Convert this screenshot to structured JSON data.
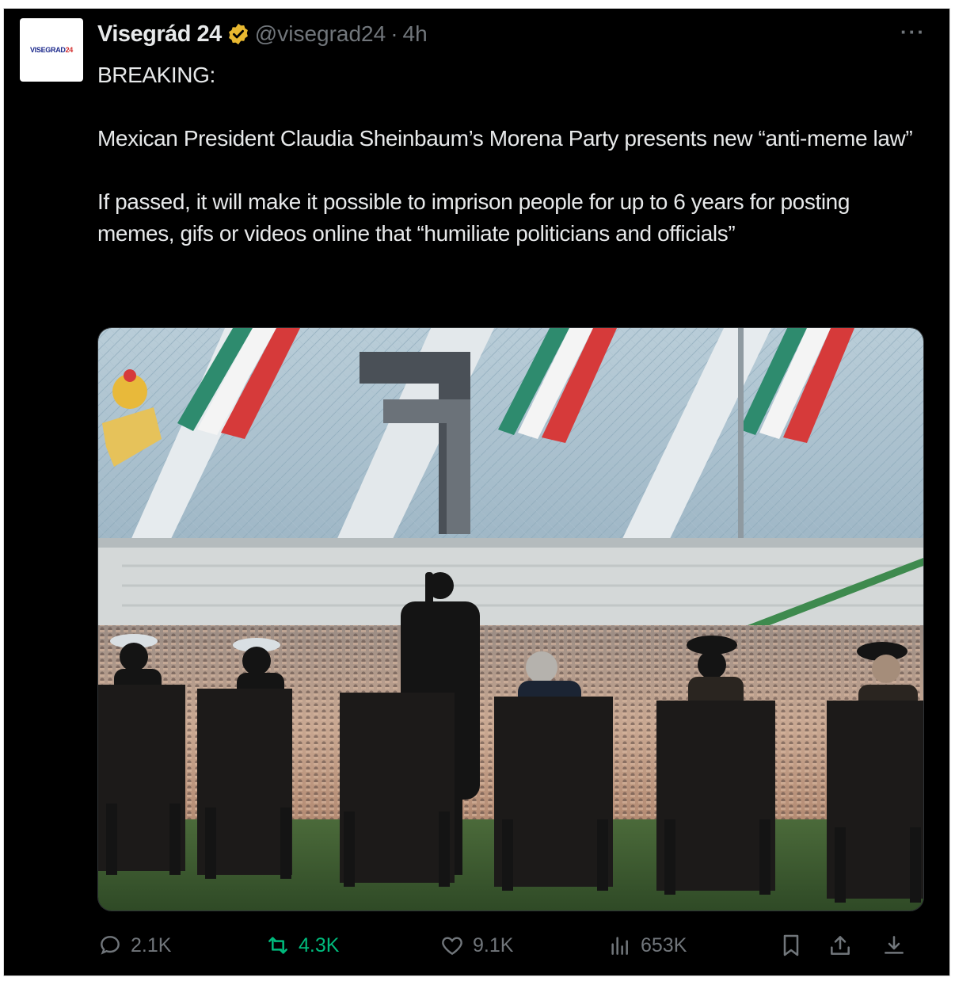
{
  "tweet": {
    "avatar_text": "VISEGRAD",
    "avatar_text_accent": "24",
    "display_name": "Visegrád 24",
    "handle": "@visegrad24",
    "separator": "·",
    "time": "4h",
    "more": "···",
    "body": {
      "p1": "BREAKING:",
      "p2": "Mexican President Claudia Sheinbaum’s Morena Party presents new “anti-meme law”",
      "p3": "If passed, it will make it possible to imprison people for up to 6 years for posting memes, gifs or videos online that “humiliate politicians and officials”"
    },
    "stats": {
      "replies": "2.1K",
      "retweets": "4.3K",
      "likes": "9.1K",
      "views": "653K"
    }
  },
  "colors": {
    "background": "#000000",
    "text": "#e7e9ea",
    "muted": "#71767b",
    "retweet_active": "#00ba7c",
    "verified": "#e8b830"
  }
}
